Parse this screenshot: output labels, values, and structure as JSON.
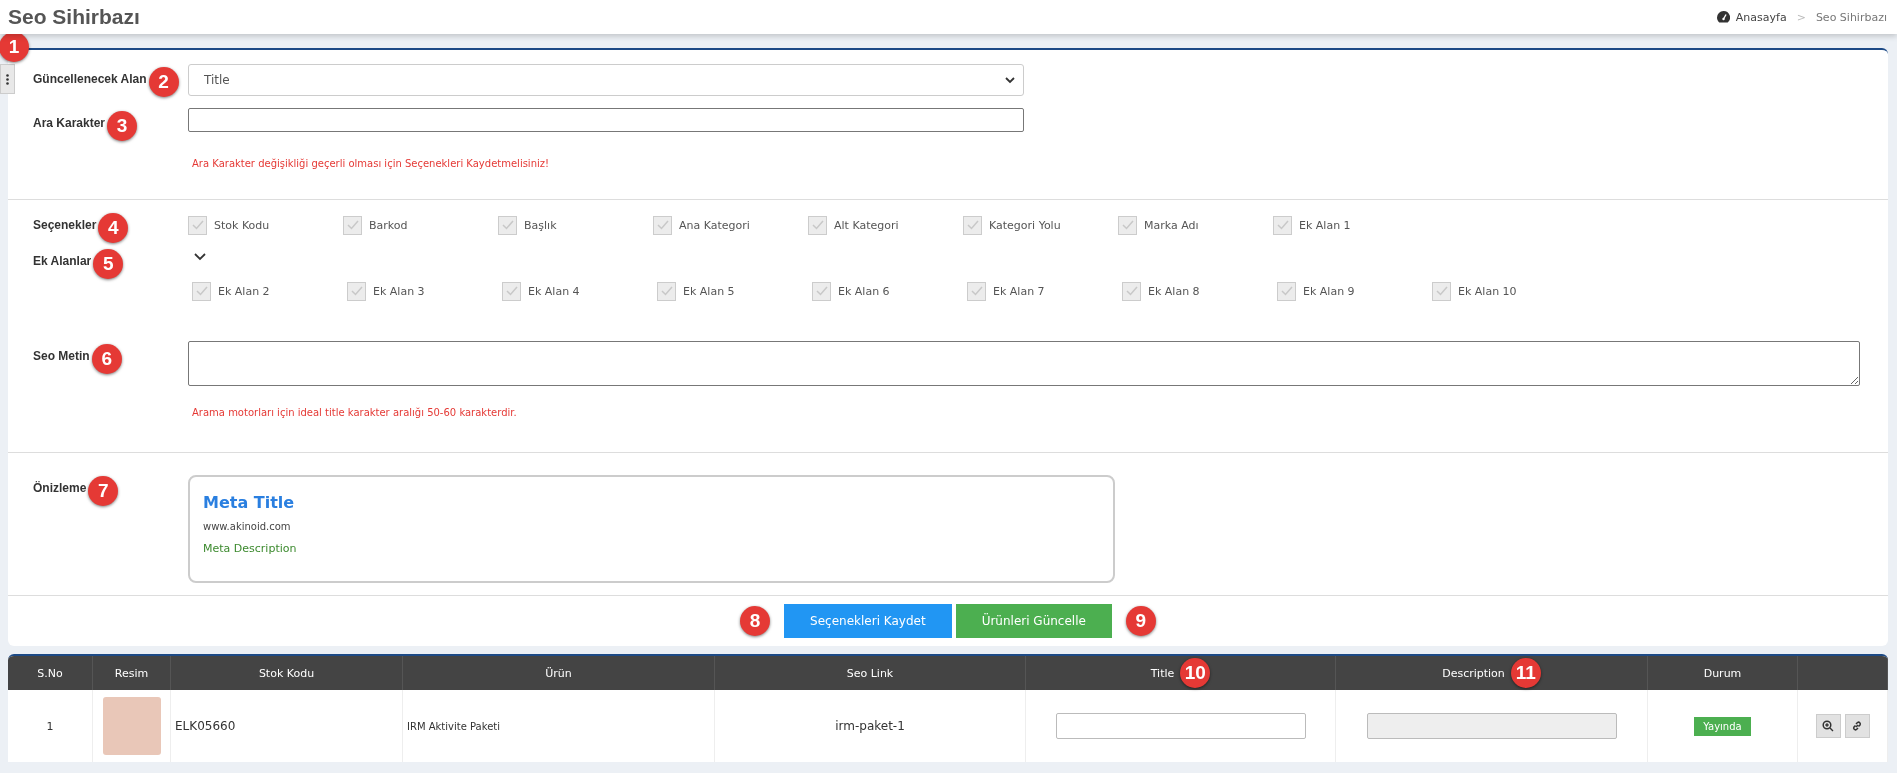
{
  "header": {
    "title": "Seo Sihirbazı",
    "breadcrumb": [
      {
        "label": "Anasayfa",
        "kind": "home"
      },
      {
        "label": "Seo Sihirbazı",
        "kind": "current"
      }
    ],
    "separator": ">"
  },
  "side_toggle": {
    "marker": "1"
  },
  "form": {
    "field": {
      "label": "Güncellenecek Alan",
      "marker": "2",
      "value": "Title"
    },
    "separator": {
      "label": "Ara Karakter",
      "marker": "3",
      "note": "Ara Karakter değişikliği geçerli olması için Seçenekleri Kaydetmelisiniz!"
    },
    "options": {
      "label": "Seçenekler",
      "marker": "4",
      "items": [
        {
          "label": "Stok Kodu",
          "checked": true
        },
        {
          "label": "Barkod",
          "checked": true
        },
        {
          "label": "Başlık",
          "checked": true
        },
        {
          "label": "Ana Kategori",
          "checked": true
        },
        {
          "label": "Alt Kategori",
          "checked": true
        },
        {
          "label": "Kategori Yolu",
          "checked": true
        },
        {
          "label": "Marka Adı",
          "checked": true
        },
        {
          "label": "Ek Alan 1",
          "checked": true
        }
      ]
    },
    "extra": {
      "label": "Ek Alanlar",
      "marker": "5",
      "expanded": true,
      "items": [
        {
          "label": "Ek Alan 2",
          "checked": true
        },
        {
          "label": "Ek Alan 3",
          "checked": true
        },
        {
          "label": "Ek Alan 4",
          "checked": true
        },
        {
          "label": "Ek Alan 5",
          "checked": true
        },
        {
          "label": "Ek Alan 6",
          "checked": true
        },
        {
          "label": "Ek Alan 7",
          "checked": true
        },
        {
          "label": "Ek Alan 8",
          "checked": true
        },
        {
          "label": "Ek Alan 9",
          "checked": true
        },
        {
          "label": "Ek Alan 10",
          "checked": true
        }
      ]
    },
    "seo_text": {
      "label": "Seo Metin",
      "marker": "6",
      "note": "Arama motorları için ideal title karakter aralığı 50-60 karakterdir."
    },
    "preview": {
      "label": "Önizleme",
      "marker": "7",
      "title": "Meta Title",
      "url": "www.akinoid.com",
      "description": "Meta Description"
    },
    "buttons": [
      {
        "label": "Seçenekleri Kaydet",
        "kind": "primary",
        "marker": "8"
      },
      {
        "label": "Ürünleri Güncelle",
        "kind": "success",
        "marker": "9"
      }
    ]
  },
  "table": {
    "columns": [
      {
        "label": "S.No"
      },
      {
        "label": "Resim"
      },
      {
        "label": "Stok Kodu"
      },
      {
        "label": "Ürün"
      },
      {
        "label": "Seo Link"
      },
      {
        "label": "Title",
        "marker": "10"
      },
      {
        "label": "Description",
        "marker": "11"
      },
      {
        "label": "Durum"
      },
      {}
    ],
    "rows": [
      {
        "no": "1",
        "stock_code": "ELK05660",
        "product": "IRM Aktivite Paketi",
        "seo_link": "irm-paket-1",
        "title": "",
        "description": "",
        "status": "Yayında"
      }
    ]
  }
}
